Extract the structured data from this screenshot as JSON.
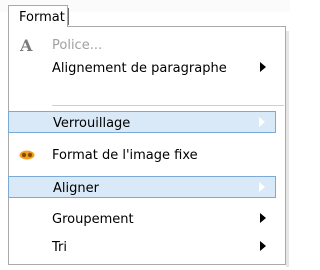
{
  "menu": {
    "title": "Format",
    "items": [
      {
        "label": "Police...",
        "enabled": false,
        "icon": "font-a-icon",
        "submenu": false
      },
      {
        "label": "Alignement de paragraphe",
        "enabled": true,
        "submenu": true
      },
      {
        "label": "Verrouillage",
        "enabled": true,
        "submenu": true,
        "highlighted": true
      },
      {
        "label": "Format de l'image fixe",
        "enabled": true,
        "icon": "image-format-icon",
        "submenu": false
      },
      {
        "label": "Aligner",
        "enabled": true,
        "submenu": true,
        "highlighted": true
      },
      {
        "label": "Groupement",
        "enabled": true,
        "submenu": true
      },
      {
        "label": "Tri",
        "enabled": true,
        "submenu": true
      }
    ]
  },
  "colors": {
    "highlight_bg": "#d9e9f7",
    "highlight_border": "#7aaad7",
    "disabled_text": "#a0a0a0",
    "image_icon_orange": "#f0a020"
  }
}
